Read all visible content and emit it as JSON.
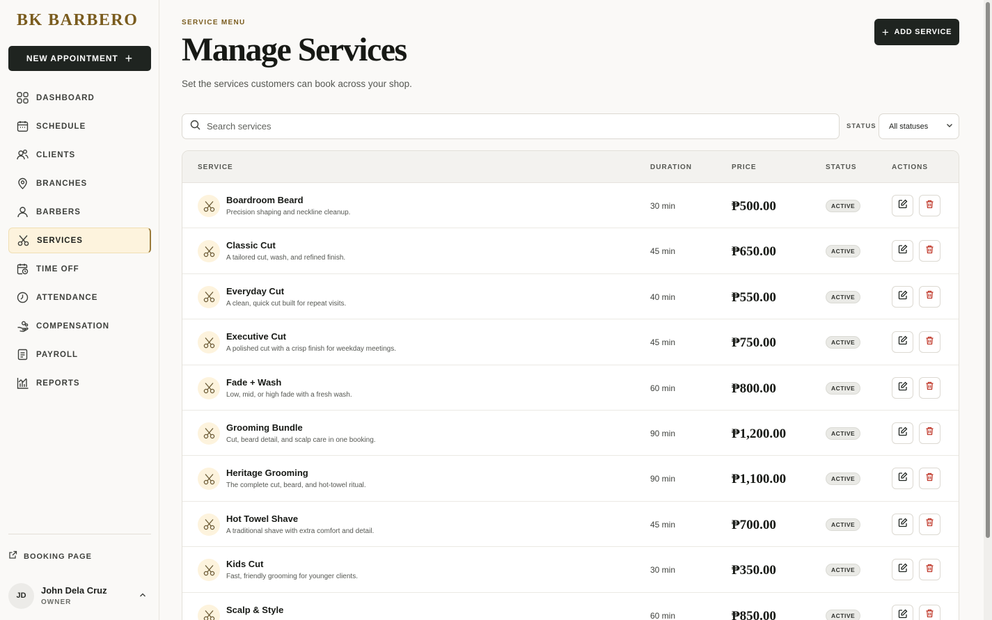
{
  "sidebar": {
    "brand": "BK BARBERO",
    "new_appointment": "NEW APPOINTMENT",
    "items": [
      {
        "label": "DASHBOARD",
        "icon": "grid-icon"
      },
      {
        "label": "SCHEDULE",
        "icon": "calendar-icon"
      },
      {
        "label": "CLIENTS",
        "icon": "users-icon"
      },
      {
        "label": "BRANCHES",
        "icon": "map-pin-icon"
      },
      {
        "label": "BARBERS",
        "icon": "user-icon"
      },
      {
        "label": "SERVICES",
        "icon": "scissors-icon",
        "active": true
      },
      {
        "label": "TIME OFF",
        "icon": "calendar-clock-icon"
      },
      {
        "label": "ATTENDANCE",
        "icon": "clock-icon"
      },
      {
        "label": "COMPENSATION",
        "icon": "hand-coins-icon"
      },
      {
        "label": "PAYROLL",
        "icon": "receipt-icon"
      },
      {
        "label": "REPORTS",
        "icon": "bar-chart-icon"
      }
    ],
    "booking_page": "BOOKING PAGE",
    "user": {
      "initials": "JD",
      "name": "John Dela Cruz",
      "role": "OWNER"
    }
  },
  "header": {
    "eyebrow": "SERVICE MENU",
    "title": "Manage Services",
    "subtitle": "Set the services customers can book across your shop.",
    "add_button": "ADD SERVICE"
  },
  "filters": {
    "search_placeholder": "Search services",
    "status_label": "STATUS",
    "status_value": "All statuses"
  },
  "table": {
    "columns": [
      "SERVICE",
      "DURATION",
      "PRICE",
      "STATUS",
      "ACTIONS"
    ],
    "rows": [
      {
        "name": "Boardroom Beard",
        "desc": "Precision shaping and neckline cleanup.",
        "duration": "30 min",
        "price": "₱500.00",
        "status": "ACTIVE"
      },
      {
        "name": "Classic Cut",
        "desc": "A tailored cut, wash, and refined finish.",
        "duration": "45 min",
        "price": "₱650.00",
        "status": "ACTIVE"
      },
      {
        "name": "Everyday Cut",
        "desc": "A clean, quick cut built for repeat visits.",
        "duration": "40 min",
        "price": "₱550.00",
        "status": "ACTIVE"
      },
      {
        "name": "Executive Cut",
        "desc": "A polished cut with a crisp finish for weekday meetings.",
        "duration": "45 min",
        "price": "₱750.00",
        "status": "ACTIVE"
      },
      {
        "name": "Fade + Wash",
        "desc": "Low, mid, or high fade with a fresh wash.",
        "duration": "60 min",
        "price": "₱800.00",
        "status": "ACTIVE"
      },
      {
        "name": "Grooming Bundle",
        "desc": "Cut, beard detail, and scalp care in one booking.",
        "duration": "90 min",
        "price": "₱1,200.00",
        "status": "ACTIVE"
      },
      {
        "name": "Heritage Grooming",
        "desc": "The complete cut, beard, and hot-towel ritual.",
        "duration": "90 min",
        "price": "₱1,100.00",
        "status": "ACTIVE"
      },
      {
        "name": "Hot Towel Shave",
        "desc": "A traditional shave with extra comfort and detail.",
        "duration": "45 min",
        "price": "₱700.00",
        "status": "ACTIVE"
      },
      {
        "name": "Kids Cut",
        "desc": "Fast, friendly grooming for younger clients.",
        "duration": "30 min",
        "price": "₱350.00",
        "status": "ACTIVE"
      },
      {
        "name": "Scalp & Style",
        "desc": "",
        "duration": "60 min",
        "price": "₱850.00",
        "status": "ACTIVE"
      }
    ]
  },
  "colors": {
    "brand": "#7a5c1e",
    "primary_button": "#1f2420",
    "active_nav_bg": "#fdf3dd",
    "delete_icon": "#c0392b"
  }
}
